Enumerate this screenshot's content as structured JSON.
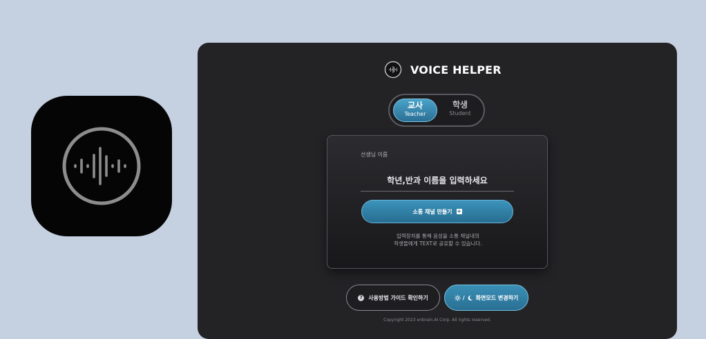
{
  "app": {
    "title": "VOICE HELPER"
  },
  "role_toggle": {
    "teacher": {
      "label": "교사",
      "sub": "Teacher"
    },
    "student": {
      "label": "학생",
      "sub": "Student"
    }
  },
  "form": {
    "field_label": "선생님 이름",
    "name_placeholder": "학년,반과 이름을 입력하세요",
    "create_button": "소통 채널 만들기",
    "description_line1": "입력장치를 통해 음성을 소통 채널내의",
    "description_line2": "학생들에게 TEXT로 공유할 수 있습니다."
  },
  "footer": {
    "guide_button": "사용방법 가이드 확인하기",
    "theme_slash": "/",
    "theme_button": "화면모드 변경하기",
    "copyright": "Copyright 2023 enbrain.AI Corp. All rights reserved."
  },
  "colors": {
    "background": "#c5d0e1",
    "window": "#232326",
    "accent": "#3c93bb"
  },
  "icons": [
    "voice-wave-app-icon",
    "voice-wave-logo-icon",
    "plus-square-icon",
    "question-circle-icon",
    "sun-icon",
    "moon-icon"
  ]
}
